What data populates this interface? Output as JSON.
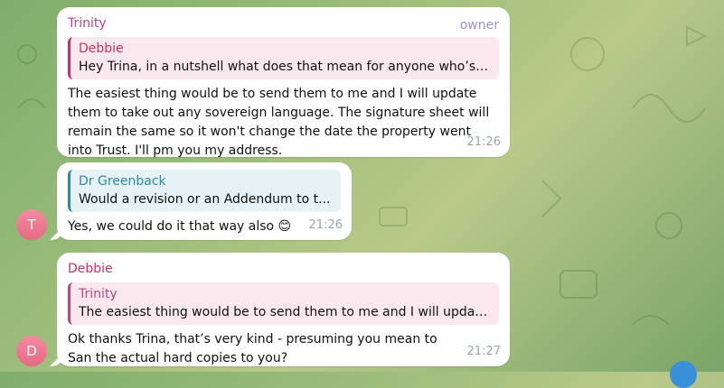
{
  "messages": [
    {
      "sender": "Trinity",
      "badge": "owner",
      "reply_to": {
        "name": "Debbie",
        "text": "Hey Trina, in a nutshell what does that mean for anyone who’s ..."
      },
      "text": "The easiest thing would be to send them to me and I will update them to take out any sovereign language. The signature sheet will remain the same so it won't change the date the property went into Trust. I'll pm you my address.",
      "time": "21:26"
    },
    {
      "reply_to": {
        "name": "Dr Greenback",
        "text": "Would a revision or an Addendum to t..."
      },
      "text": "Yes, we could do it that way also",
      "emoji": "😊",
      "time": "21:26",
      "avatar": "T"
    },
    {
      "sender": "Debbie",
      "reply_to": {
        "name": "Trinity",
        "text": "The easiest thing would be to send them to me and I will updat..."
      },
      "text": "Ok thanks Trina, that’s very kind - presuming you mean to San the actual hard copies to you?",
      "time": "21:27",
      "avatar": "D"
    }
  ],
  "colors": {
    "trinity_name": "#b5467f",
    "debbie_name": "#c2335f",
    "debbie_reply_bg": "#fbe8ee",
    "greenback_name": "#2e8a9e",
    "greenback_reply_bg": "#e6f2f5",
    "trinity_reply_bg": "#fbe8ee"
  }
}
